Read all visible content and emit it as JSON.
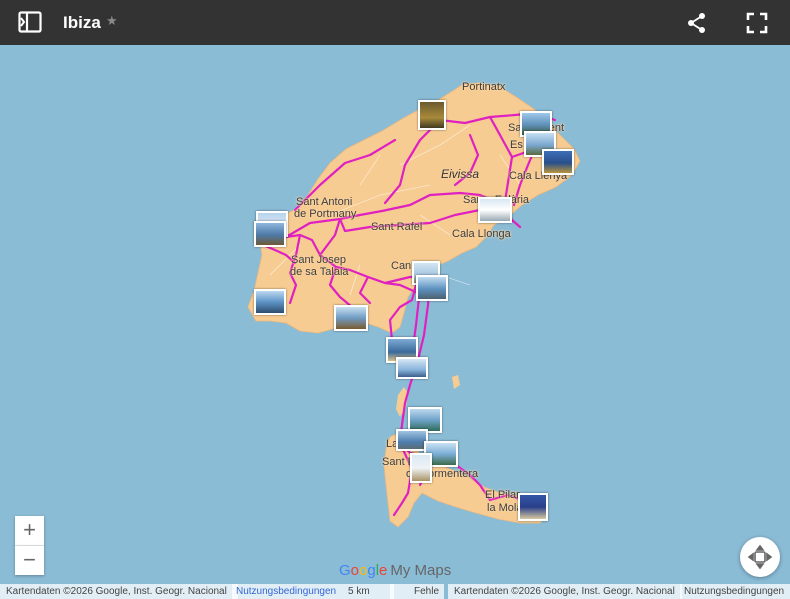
{
  "map": {
    "title": "Ibiza",
    "star_icon": "★",
    "icons": [
      "sidebar-toggle-icon",
      "star-icon",
      "share-icon",
      "fullscreen-icon",
      "plus-icon",
      "minus-icon",
      "locate-icon"
    ],
    "colors": {
      "topbar": "#333333",
      "sea": "#8bbcd6",
      "land": "#f7cc93",
      "route": "#e020c0"
    },
    "labels": {
      "portinatx": "Portinatx",
      "eivissa": "Eivissa",
      "sant_antoni": "Sant Antoni",
      "de_portmany": "de Portmany",
      "sant_rafel": "Sant Rafel",
      "cala_llonga": "Cala Llonga",
      "cala_llenya": "Cala Llenya",
      "santa_eularia": "Santa Eulària",
      "sant_josep": "Sant Josep",
      "de_sa_talaia": "de sa Talaia",
      "can": "Can",
      "sant_vicent": "Sant Vicent",
      "es": "Es",
      "la": "La",
      "sant_francesc": "Sant Francesc",
      "de_formentera": "de Formentera",
      "el_pilar": "El Pilar",
      "la_mola": "la Mola"
    },
    "zoom": {
      "in": "+",
      "out": "−"
    },
    "logo": {
      "google": "Google",
      "mymaps": "My Maps"
    },
    "footer": {
      "attribution": "Kartendaten ©2026 Google, Inst. Geogr. Nacional",
      "terms": "Nutzungsbedingungen",
      "scale": "5 km",
      "report": "Fehle",
      "attribution2": "Kartendaten ©2026 Google, Inst. Geogr. Nacional",
      "terms2": "Nutzungsbedingungen"
    }
  }
}
